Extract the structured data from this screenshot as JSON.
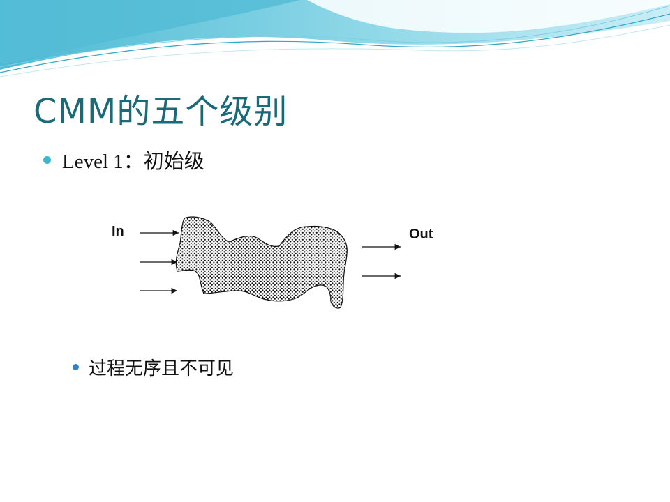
{
  "slide": {
    "title": "CMM的五个级别",
    "bullet_level1": "Level 1：初始级",
    "bullet_level2": "过程无序且不可见"
  },
  "diagram": {
    "input_label": "In",
    "output_label": "Out"
  },
  "colors": {
    "title": "#1a6a78",
    "bullet_primary": "#3ab8cf",
    "bullet_secondary": "#2e84c6",
    "wave_light": "#d4f0f7",
    "wave_mid": "#8ed9ea",
    "wave_dark": "#3fb7d1"
  }
}
